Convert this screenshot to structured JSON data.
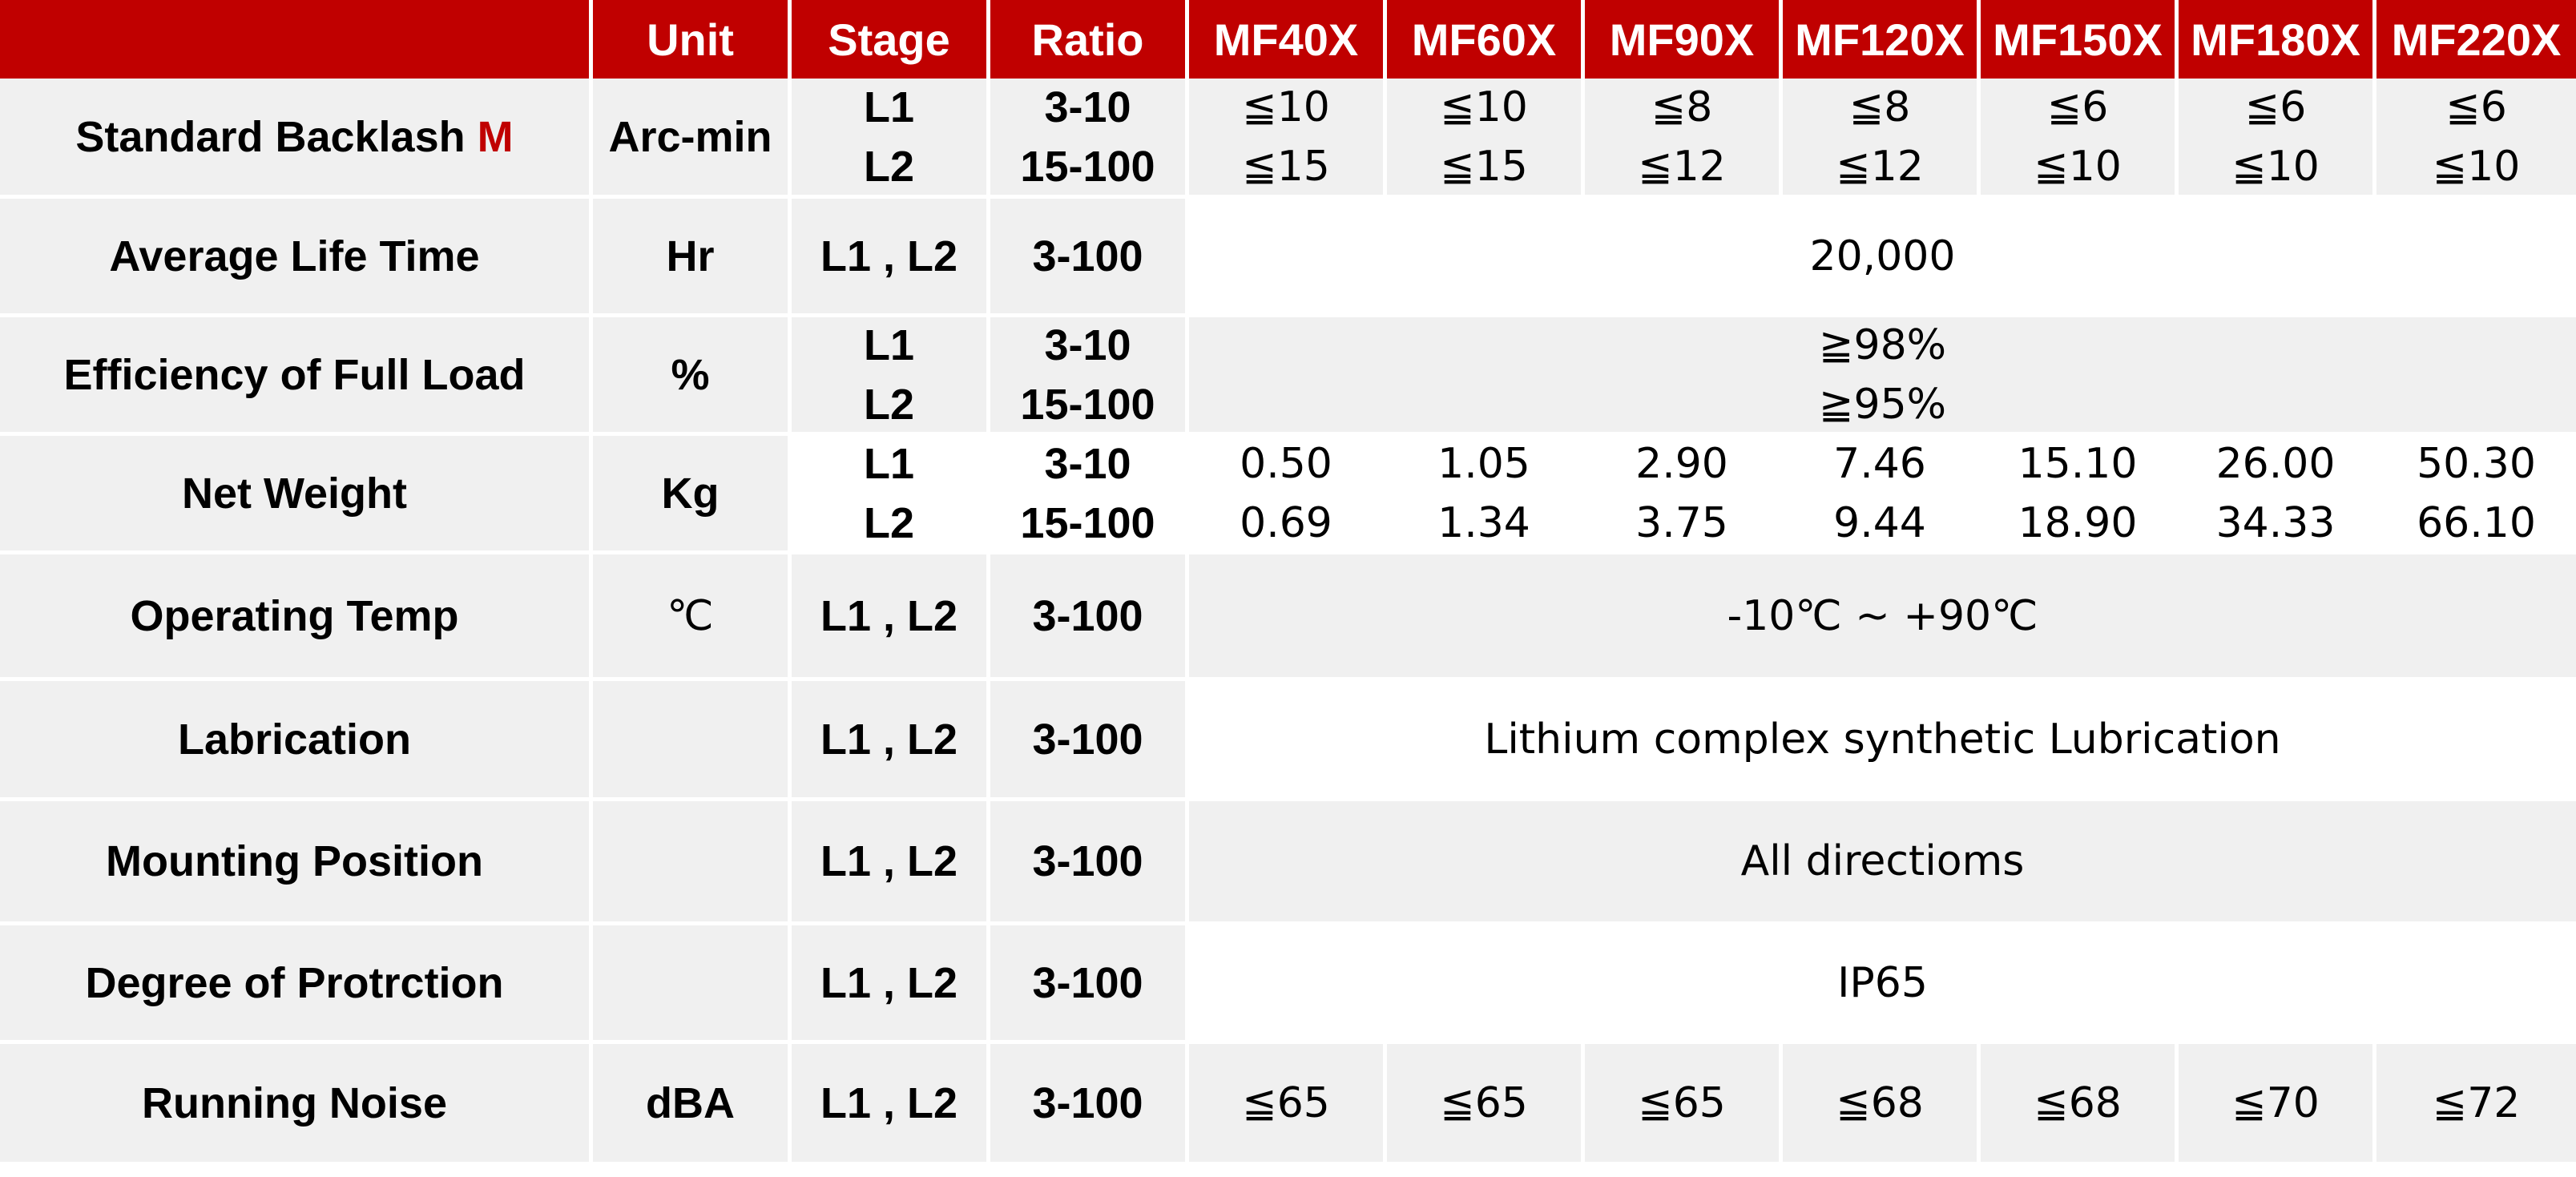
{
  "header": {
    "blank": "",
    "unit": "Unit",
    "stage": "Stage",
    "ratio": "Ratio",
    "models": [
      "MF40X",
      "MF60X",
      "MF90X",
      "MF120X",
      "MF150X",
      "MF180X",
      "MF220X"
    ]
  },
  "rows": {
    "backlash": {
      "label": "Standard Backlash",
      "label_mark": "M",
      "unit": "Arc-min",
      "stage_l1": "L1",
      "stage_l2": "L2",
      "ratio_l1": "3-10",
      "ratio_l2": "15-100",
      "l1": [
        "≦10",
        "≦10",
        "≦8",
        "≦8",
        "≦6",
        "≦6",
        "≦6"
      ],
      "l2": [
        "≦15",
        "≦15",
        "≦12",
        "≦12",
        "≦10",
        "≦10",
        "≦10"
      ]
    },
    "life": {
      "label": "Average Life Time",
      "unit": "Hr",
      "stage": "L1 , L2",
      "ratio": "3-100",
      "value": "20,000"
    },
    "efficiency": {
      "label": "Efficiency of Full Load",
      "unit": "%",
      "stage_l1": "L1",
      "stage_l2": "L2",
      "ratio_l1": "3-10",
      "ratio_l2": "15-100",
      "value_l1": "≧98%",
      "value_l2": "≧95%"
    },
    "weight": {
      "label": "Net Weight",
      "unit": "Kg",
      "stage_l1": "L1",
      "stage_l2": "L2",
      "ratio_l1": "3-10",
      "ratio_l2": "15-100",
      "l1": [
        "0.50",
        "1.05",
        "2.90",
        "7.46",
        "15.10",
        "26.00",
        "50.30"
      ],
      "l2": [
        "0.69",
        "1.34",
        "3.75",
        "9.44",
        "18.90",
        "34.33",
        "66.10"
      ]
    },
    "temp": {
      "label": "Operating Temp",
      "unit": "℃",
      "stage": "L1 , L2",
      "ratio": "3-100",
      "value": "-10℃ ~ +90℃"
    },
    "lubrication": {
      "label": "Labrication",
      "unit": "",
      "stage": "L1 , L2",
      "ratio": "3-100",
      "value": "Lithium complex synthetic Lubrication"
    },
    "mounting": {
      "label": "Mounting Position",
      "unit": "",
      "stage": "L1 , L2",
      "ratio": "3-100",
      "value": "All directioms"
    },
    "protection": {
      "label": "Degree of Protrction",
      "unit": "",
      "stage": "L1 , L2",
      "ratio": "3-100",
      "value": "IP65"
    },
    "noise": {
      "label": "Running Noise",
      "unit": "dBA",
      "stage": "L1 , L2",
      "ratio": "3-100",
      "values": [
        "≦65",
        "≦65",
        "≦65",
        "≦68",
        "≦68",
        "≦70",
        "≦72"
      ]
    }
  },
  "colors": {
    "header_bg": "#c00000",
    "row_grey": "#f0f0f0",
    "mark": "#c00000"
  }
}
